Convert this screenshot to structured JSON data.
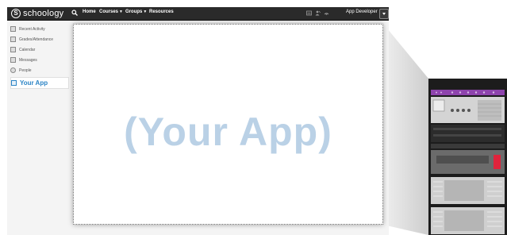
{
  "header": {
    "logo_text": "schoology",
    "nav": [
      {
        "label": "Home",
        "caret": false
      },
      {
        "label": "Courses",
        "caret": true
      },
      {
        "label": "Groups",
        "caret": true
      },
      {
        "label": "Resources",
        "caret": false
      }
    ],
    "user_label": "App Developer",
    "icons": [
      "search-icon",
      "messages-icon",
      "requests-icon",
      "notifications-icon",
      "user-menu-icon"
    ]
  },
  "sidebar": {
    "items": [
      {
        "label": "Recent Activity",
        "icon": "activity-icon"
      },
      {
        "label": "Grades/Attendance",
        "icon": "grades-icon"
      },
      {
        "label": "Calendar",
        "icon": "calendar-icon"
      },
      {
        "label": "Messages",
        "icon": "messages-icon"
      },
      {
        "label": "People",
        "icon": "people-icon"
      },
      {
        "label": "Your App",
        "icon": "app-icon",
        "active": true
      }
    ]
  },
  "main": {
    "placeholder_text": "(Your App)"
  },
  "colors": {
    "topbar": "#2a2a2a",
    "accent": "#2b84c5",
    "placeholder": "#bad1e6",
    "rack_accent": "#8e44ad",
    "rack_alert": "#e0233c"
  }
}
